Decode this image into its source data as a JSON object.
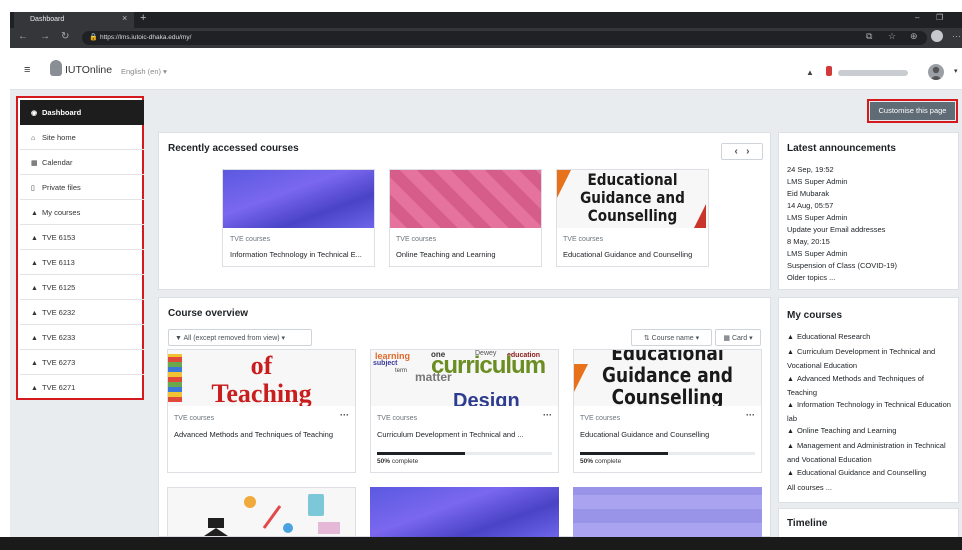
{
  "browser": {
    "tab_title": "Dashboard",
    "url": "https://lms.iutoic-dhaka.edu/my/",
    "tab_close": "×",
    "new_tab": "+",
    "minimize": "–",
    "maximize": "❐"
  },
  "navbar": {
    "brand": "IUTOnline",
    "language": "English (en) ▾"
  },
  "sidebar": {
    "items": [
      {
        "label": "Dashboard",
        "icon": "dashboard-icon"
      },
      {
        "label": "Site home",
        "icon": "home-icon"
      },
      {
        "label": "Calendar",
        "icon": "calendar-icon"
      },
      {
        "label": "Private files",
        "icon": "file-icon"
      },
      {
        "label": "My courses",
        "icon": "graduation-cap-icon"
      },
      {
        "label": "TVE 6153",
        "icon": "graduation-cap-icon"
      },
      {
        "label": "TVE 6113",
        "icon": "graduation-cap-icon"
      },
      {
        "label": "TVE 6125",
        "icon": "graduation-cap-icon"
      },
      {
        "label": "TVE 6232",
        "icon": "graduation-cap-icon"
      },
      {
        "label": "TVE 6233",
        "icon": "graduation-cap-icon"
      },
      {
        "label": "TVE 6273",
        "icon": "graduation-cap-icon"
      },
      {
        "label": "TVE 6271",
        "icon": "graduation-cap-icon"
      }
    ]
  },
  "customise_label": "Customise this page",
  "recent": {
    "title": "Recently accessed courses",
    "courses": [
      {
        "category": "TVE courses",
        "name": "Information Technology in Technical E..."
      },
      {
        "category": "TVE courses",
        "name": "Online Teaching and Learning"
      },
      {
        "category": "TVE courses",
        "name": "Educational Guidance and Counselling"
      }
    ],
    "thumb_text_3": [
      "Educational",
      "Guidance and",
      "Counselling"
    ]
  },
  "overview": {
    "title": "Course overview",
    "filter_label": "All (except removed from view) ▾",
    "sort_label": "Course name ▾",
    "view_label": "Card ▾",
    "courses": [
      {
        "category": "TVE courses",
        "name": "Advanced Methods and Techniques of Teaching",
        "thumb_text": [
          "of",
          "Teaching"
        ]
      },
      {
        "category": "TVE courses",
        "name": "Curriculum Development in Technical and ...",
        "progress": 50,
        "progress_pct": "50%",
        "progress_suffix": " complete",
        "thumb_text": [
          "curriculum",
          "Design",
          "learning",
          "subject",
          "matter",
          "one",
          "Dewey",
          "education",
          "term"
        ]
      },
      {
        "category": "TVE courses",
        "name": "Educational Guidance and Counselling",
        "progress": 50,
        "progress_pct": "50%",
        "progress_suffix": " complete",
        "thumb_text": [
          "Educational",
          "Guidance and",
          "Counselling"
        ]
      }
    ]
  },
  "announcements": {
    "title": "Latest announcements",
    "lines": [
      "24 Sep, 19:52",
      "LMS Super Admin",
      "Eid Mubarak",
      "14 Aug, 05:57",
      "LMS Super Admin",
      "Update your Email addresses",
      "8 May, 20:15",
      "LMS Super Admin",
      "Suspension of Class (COVID-19)",
      "Older topics ..."
    ]
  },
  "my_courses": {
    "title": "My courses",
    "items": [
      "Educational Research",
      "Curriculum Development in Technical and Vocational Education",
      "Advanced Methods and Techniques of Teaching",
      "Information Technology in Technical Education lab",
      "Online Teaching and Learning",
      "Management and Administration in Technical and Vocational Education",
      "Educational Guidance and Counselling"
    ],
    "all_label": "All courses ..."
  },
  "timeline": {
    "title": "Timeline"
  },
  "colors": {
    "highlight": "#d6191c",
    "accent": "#5f6b75"
  }
}
